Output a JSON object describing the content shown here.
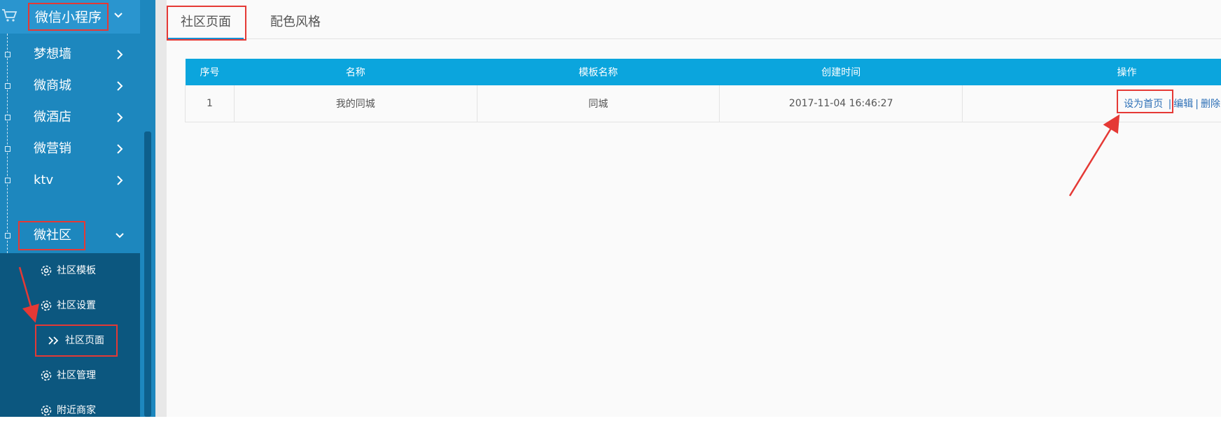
{
  "sidebar": {
    "header_title": "微信小程序",
    "items": [
      {
        "label": "梦想墙"
      },
      {
        "label": "微商城"
      },
      {
        "label": "微酒店"
      },
      {
        "label": "微营销"
      },
      {
        "label": "ktv"
      },
      {
        "label": "微社区"
      }
    ],
    "submenu": [
      {
        "label": "社区模板"
      },
      {
        "label": "社区设置"
      },
      {
        "label": "社区页面"
      },
      {
        "label": "社区管理"
      },
      {
        "label": "附近商家"
      }
    ]
  },
  "tabs": [
    {
      "label": "社区页面"
    },
    {
      "label": "配色风格"
    }
  ],
  "table": {
    "headers": [
      "序号",
      "名称",
      "模板名称",
      "创建时间",
      "操作"
    ],
    "rows": [
      {
        "index": "1",
        "name": "我的同城",
        "template": "同城",
        "created": "2017-11-04 16:46:27",
        "actions": {
          "set_home": "设为首页",
          "edit": "编辑",
          "delete": "删除",
          "sep": "|"
        }
      }
    ]
  },
  "colors": {
    "sidebar_bg": "#1d87be",
    "submenu_bg": "#0c577f",
    "table_header_bg": "#0ba5dd",
    "highlight_red": "#e53935",
    "link_blue": "#2d70b7"
  }
}
